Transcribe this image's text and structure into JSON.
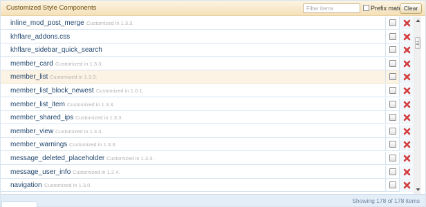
{
  "header": {
    "title": "Customized Style Components",
    "filter_placeholder": "Filter items",
    "prefix_label": "Prefix match",
    "clear_label": "Clear"
  },
  "rows": [
    {
      "name": "inline_mod_post_merge",
      "note": "Customized in 1.3.3."
    },
    {
      "name": "khflare_addons.css",
      "note": ""
    },
    {
      "name": "khflare_sidebar_quick_search",
      "note": ""
    },
    {
      "name": "member_card",
      "note": "Customized in 1.3.3."
    },
    {
      "name": "member_list",
      "note": "Customized in 1.3.3."
    },
    {
      "name": "member_list_block_newest",
      "note": "Customized in 1.0.1."
    },
    {
      "name": "member_list_item",
      "note": "Customized in 1.3.3."
    },
    {
      "name": "member_shared_ips",
      "note": "Customized in 1.3.3."
    },
    {
      "name": "member_view",
      "note": "Customized in 1.3.3."
    },
    {
      "name": "member_warnings",
      "note": "Customized in 1.3.3."
    },
    {
      "name": "message_deleted_placeholder",
      "note": "Customized in 1.3.3."
    },
    {
      "name": "message_user_info",
      "note": "Customized in 1.2.4."
    },
    {
      "name": "navigation",
      "note": "Customized in 1.3.0."
    }
  ],
  "highlighted_row": 4,
  "footer": {
    "status": "Showing 178 of 178 items"
  },
  "colors": {
    "header_bg": "#f5e1b9",
    "link": "#22476e",
    "delete": "#d43b3b",
    "highlight_row": "#fdf3e4"
  },
  "icons": {
    "delete": "delete-x-icon",
    "scroll_up": "chevron-up-icon",
    "scroll_down": "chevron-down-icon"
  }
}
